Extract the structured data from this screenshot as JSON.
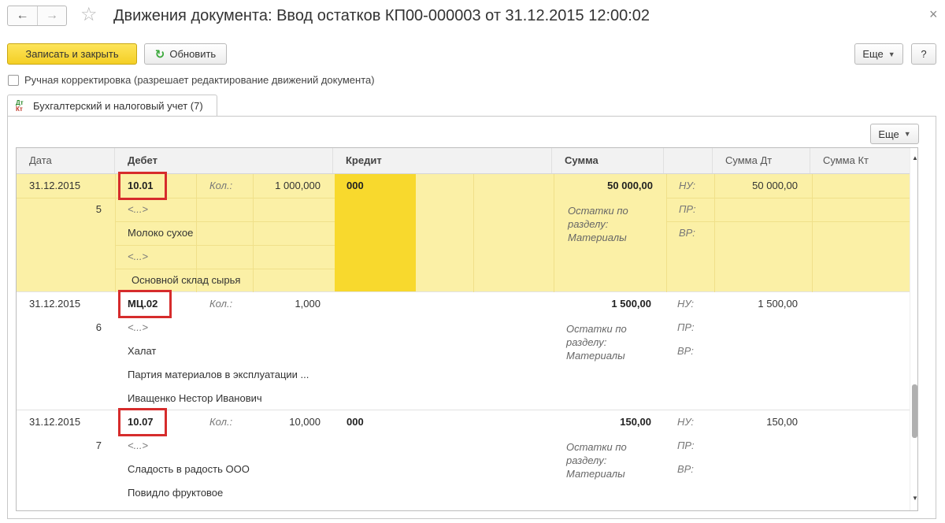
{
  "window": {
    "title": "Движения документа: Ввод остатков КП00-000003 от 31.12.2015 12:00:02",
    "nav_back_icon": "arrow-left-icon",
    "nav_forward_icon": "arrow-right-icon",
    "favorite_icon": "star-icon"
  },
  "toolbar": {
    "save_close_label": "Записать и закрыть",
    "refresh_label": "Обновить",
    "more_label": "Еще",
    "help_label": "?"
  },
  "manual_edit": {
    "checked": false,
    "label": "Ручная корректировка (разрешает редактирование движений документа)"
  },
  "tabs": [
    {
      "label": "Бухгалтерский и налоговый учет (7)",
      "icon_top": "Дт",
      "icon_bottom": "Кт"
    }
  ],
  "table_toolbar": {
    "more_label": "Еще"
  },
  "table": {
    "columns": [
      "Дата",
      "Дебет",
      "Кредит",
      "Сумма",
      "Сумма Дт",
      "Сумма Кт"
    ],
    "rows": [
      {
        "date": "31.12.2015",
        "index": "5",
        "debit_account": "10.01",
        "qty_label": "Кол.:",
        "qty": "1 000,000",
        "debit_sub1": "<...>",
        "debit_sub2": "Молоко сухое",
        "debit_sub3": "<...>",
        "debit_sub4": "Основной склад сырья",
        "credit_account": "000",
        "sum": "50 000,00",
        "content": "Остатки по разделу: Материалы",
        "nu_label": "НУ:",
        "pr_label": "ПР:",
        "vr_label": "ВР:",
        "sum_dt": "50 000,00",
        "sum_kt": ""
      },
      {
        "date": "31.12.2015",
        "index": "6",
        "debit_account": "МЦ.02",
        "qty_label": "Кол.:",
        "qty": "1,000",
        "debit_sub1": "<...>",
        "debit_sub2": "Халат",
        "debit_sub3": "Партия материалов в эксплуатации ...",
        "debit_sub4": "Иващенко Нестор Иванович",
        "credit_account": "",
        "sum": "1 500,00",
        "content": "Остатки по разделу: Материалы",
        "nu_label": "НУ:",
        "pr_label": "ПР:",
        "vr_label": "ВР:",
        "sum_dt": "1 500,00",
        "sum_kt": ""
      },
      {
        "date": "31.12.2015",
        "index": "7",
        "debit_account": "10.07",
        "qty_label": "Кол.:",
        "qty": "10,000",
        "debit_sub1": "<...>",
        "debit_sub2": "Сладость в радость ООО",
        "debit_sub3": "Повидло фруктовое",
        "debit_sub4": "",
        "credit_account": "000",
        "sum": "150,00",
        "content": "Остатки по разделу: Материалы",
        "nu_label": "НУ:",
        "pr_label": "ПР:",
        "vr_label": "ВР:",
        "sum_dt": "150,00",
        "sum_kt": ""
      }
    ]
  },
  "colors": {
    "primary_button": "#f4cf25",
    "selected_row": "#fbf0a6",
    "selected_cell": "#f8d92d",
    "highlight_box": "#d62c2c"
  }
}
